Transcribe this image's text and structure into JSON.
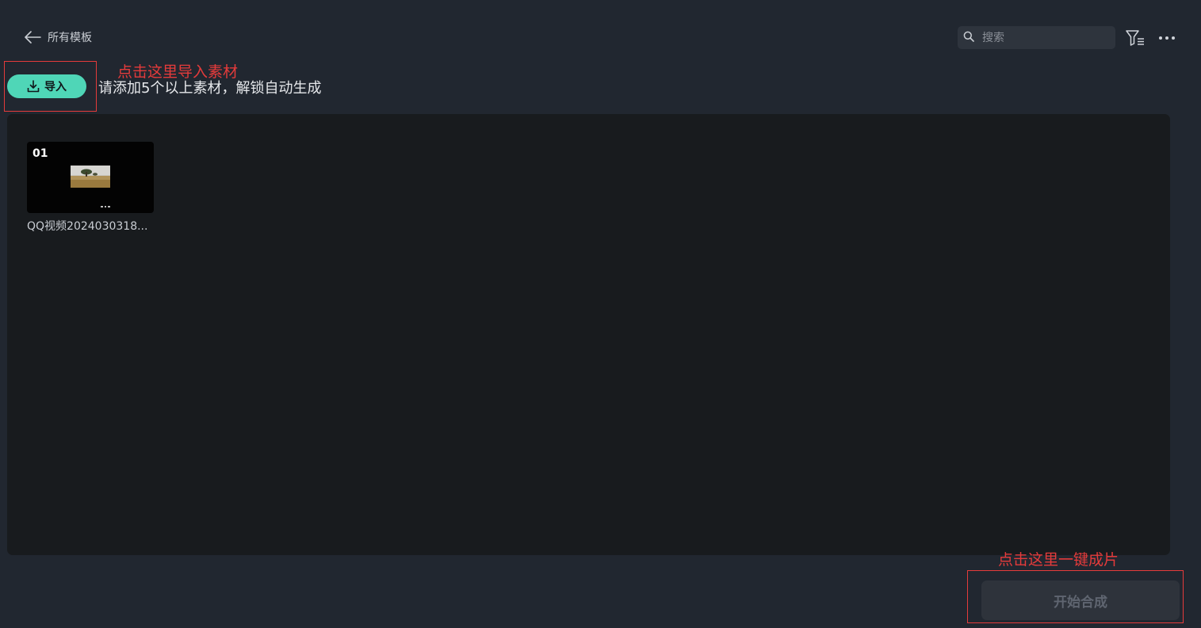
{
  "header": {
    "back_label": "所有模板",
    "search": {
      "placeholder": "搜索",
      "value": ""
    },
    "icons": [
      "back-arrow-icon",
      "search-icon",
      "filter-icon",
      "more-icon"
    ]
  },
  "toolbar": {
    "import_label": "导入",
    "hint": "请添加5个以上素材，解锁自动生成"
  },
  "materials": [
    {
      "index": "01",
      "name": "QQ视频2024030318..."
    }
  ],
  "footer": {
    "start_label": "开始合成"
  },
  "annotations": {
    "import_note": "点击这里导入素材",
    "start_note": "点击这里一键成片"
  },
  "colors": {
    "background": "#212730",
    "panel": "#181b1e",
    "accent": "#4fd6b7",
    "annotation": "#e53b3b",
    "disabled_button": "#2e333b"
  }
}
